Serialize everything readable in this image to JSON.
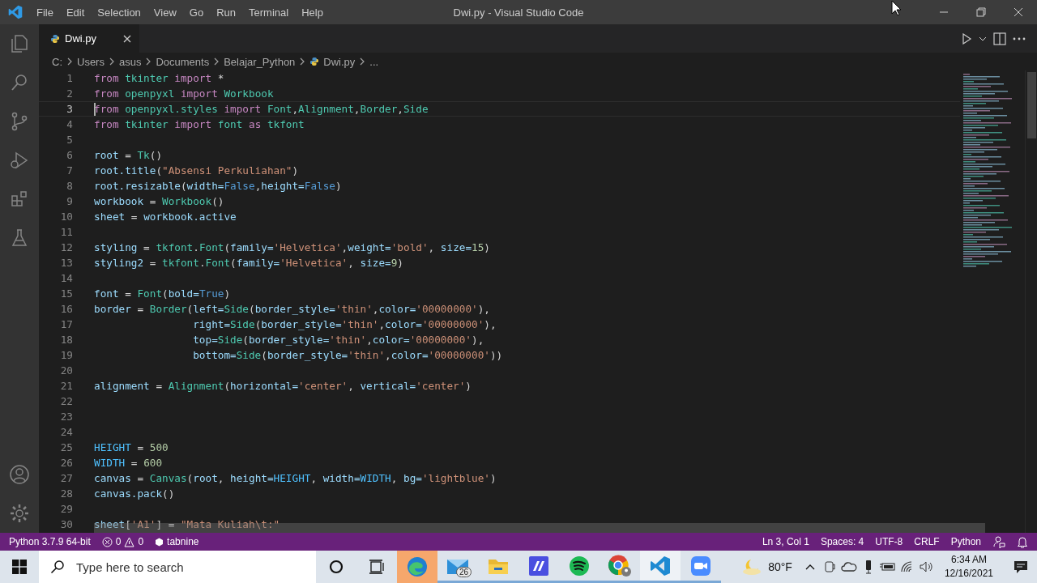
{
  "window": {
    "title": "Dwi.py - Visual Studio Code"
  },
  "menu": [
    "File",
    "Edit",
    "Selection",
    "View",
    "Go",
    "Run",
    "Terminal",
    "Help"
  ],
  "tabs": [
    {
      "label": "Dwi.py",
      "selected": true
    }
  ],
  "breadcrumbs": [
    {
      "label": "C:",
      "kind": "text"
    },
    {
      "label": "Users",
      "kind": "text"
    },
    {
      "label": "asus",
      "kind": "text"
    },
    {
      "label": "Documents",
      "kind": "text"
    },
    {
      "label": "Belajar_Python",
      "kind": "text"
    },
    {
      "label": "Dwi.py",
      "kind": "file"
    },
    {
      "label": "...",
      "kind": "text"
    }
  ],
  "lines": [
    {
      "number": "1",
      "current": false,
      "tokens": [
        {
          "text": "from",
          "kind": "kw"
        },
        {
          "text": " tkinter",
          "kind": "mod"
        },
        {
          "text": " import",
          "kind": "kw"
        },
        {
          "text": " *",
          "kind": "op"
        }
      ]
    },
    {
      "number": "2",
      "current": false,
      "tokens": [
        {
          "text": "from",
          "kind": "kw"
        },
        {
          "text": " openpyxl",
          "kind": "mod"
        },
        {
          "text": " import",
          "kind": "kw"
        },
        {
          "text": " Workbook",
          "kind": "cls"
        }
      ]
    },
    {
      "number": "3",
      "current": true,
      "tokens": [
        {
          "text": "from",
          "kind": "kw"
        },
        {
          "text": " openpyxl.styles",
          "kind": "mod"
        },
        {
          "text": " import",
          "kind": "kw"
        },
        {
          "text": " Font",
          "kind": "cls"
        },
        {
          "text": ",",
          "kind": "op"
        },
        {
          "text": "Alignment",
          "kind": "cls"
        },
        {
          "text": ",",
          "kind": "op"
        },
        {
          "text": "Border",
          "kind": "cls"
        },
        {
          "text": ",",
          "kind": "op"
        },
        {
          "text": "Side",
          "kind": "cls"
        }
      ]
    },
    {
      "number": "4",
      "current": false,
      "tokens": [
        {
          "text": "from",
          "kind": "kw"
        },
        {
          "text": " tkinter",
          "kind": "mod"
        },
        {
          "text": " import",
          "kind": "kw"
        },
        {
          "text": " font",
          "kind": "mod"
        },
        {
          "text": " as",
          "kind": "kw"
        },
        {
          "text": " tkfont",
          "kind": "mod"
        }
      ]
    },
    {
      "number": "5",
      "current": false
    },
    {
      "number": "6",
      "current": false,
      "tokens": [
        {
          "text": "root",
          "kind": "var"
        },
        {
          "text": " = ",
          "kind": "op"
        },
        {
          "text": "Tk",
          "kind": "cls"
        },
        {
          "text": "()",
          "kind": "op"
        }
      ]
    },
    {
      "number": "7",
      "current": false,
      "tokens": [
        {
          "text": "root.title",
          "kind": "var"
        },
        {
          "text": "(",
          "kind": "op"
        },
        {
          "text": "\"Absensi Perkuliahan\"",
          "kind": "str"
        },
        {
          "text": ")",
          "kind": "op"
        }
      ]
    },
    {
      "number": "8",
      "current": false,
      "tokens": [
        {
          "text": "root.resizable",
          "kind": "var"
        },
        {
          "text": "(",
          "kind": "op"
        },
        {
          "text": "width=",
          "kind": "var"
        },
        {
          "text": "False",
          "kind": "bool"
        },
        {
          "text": ",",
          "kind": "op"
        },
        {
          "text": "height=",
          "kind": "var"
        },
        {
          "text": "False",
          "kind": "bool"
        },
        {
          "text": ")",
          "kind": "op"
        }
      ]
    },
    {
      "number": "9",
      "current": false,
      "tokens": [
        {
          "text": "workbook",
          "kind": "var"
        },
        {
          "text": " = ",
          "kind": "op"
        },
        {
          "text": "Workbook",
          "kind": "cls"
        },
        {
          "text": "()",
          "kind": "op"
        }
      ]
    },
    {
      "number": "10",
      "current": false,
      "tokens": [
        {
          "text": "sheet",
          "kind": "var"
        },
        {
          "text": " = ",
          "kind": "op"
        },
        {
          "text": "workbook.active",
          "kind": "var"
        }
      ]
    },
    {
      "number": "11",
      "current": false
    },
    {
      "number": "12",
      "current": false,
      "tokens": [
        {
          "text": "styling",
          "kind": "var"
        },
        {
          "text": " = ",
          "kind": "op"
        },
        {
          "text": "tkfont",
          "kind": "mod"
        },
        {
          "text": ".",
          "kind": "op"
        },
        {
          "text": "Font",
          "kind": "cls"
        },
        {
          "text": "(",
          "kind": "op"
        },
        {
          "text": "family=",
          "kind": "var"
        },
        {
          "text": "'Helvetica'",
          "kind": "str"
        },
        {
          "text": ",",
          "kind": "op"
        },
        {
          "text": "weight=",
          "kind": "var"
        },
        {
          "text": "'bold'",
          "kind": "str"
        },
        {
          "text": ", ",
          "kind": "op"
        },
        {
          "text": "size=",
          "kind": "var"
        },
        {
          "text": "15",
          "kind": "num"
        },
        {
          "text": ")",
          "kind": "op"
        }
      ]
    },
    {
      "number": "13",
      "current": false,
      "tokens": [
        {
          "text": "styling2",
          "kind": "var"
        },
        {
          "text": " = ",
          "kind": "op"
        },
        {
          "text": "tkfont",
          "kind": "mod"
        },
        {
          "text": ".",
          "kind": "op"
        },
        {
          "text": "Font",
          "kind": "cls"
        },
        {
          "text": "(",
          "kind": "op"
        },
        {
          "text": "family=",
          "kind": "var"
        },
        {
          "text": "'Helvetica'",
          "kind": "str"
        },
        {
          "text": ", ",
          "kind": "op"
        },
        {
          "text": "size=",
          "kind": "var"
        },
        {
          "text": "9",
          "kind": "num"
        },
        {
          "text": ")",
          "kind": "op"
        }
      ]
    },
    {
      "number": "14",
      "current": false
    },
    {
      "number": "15",
      "current": false,
      "tokens": [
        {
          "text": "font",
          "kind": "var"
        },
        {
          "text": " = ",
          "kind": "op"
        },
        {
          "text": "Font",
          "kind": "cls"
        },
        {
          "text": "(",
          "kind": "op"
        },
        {
          "text": "bold=",
          "kind": "var"
        },
        {
          "text": "True",
          "kind": "bool"
        },
        {
          "text": ")",
          "kind": "op"
        }
      ]
    },
    {
      "number": "16",
      "current": false,
      "tokens": [
        {
          "text": "border",
          "kind": "var"
        },
        {
          "text": " = ",
          "kind": "op"
        },
        {
          "text": "Border",
          "kind": "cls"
        },
        {
          "text": "(",
          "kind": "op"
        },
        {
          "text": "left=",
          "kind": "var"
        },
        {
          "text": "Side",
          "kind": "cls"
        },
        {
          "text": "(",
          "kind": "op"
        },
        {
          "text": "border_style=",
          "kind": "var"
        },
        {
          "text": "'thin'",
          "kind": "str"
        },
        {
          "text": ",",
          "kind": "op"
        },
        {
          "text": "color=",
          "kind": "var"
        },
        {
          "text": "'00000000'",
          "kind": "str"
        },
        {
          "text": "),",
          "kind": "op"
        }
      ]
    },
    {
      "number": "17",
      "current": false,
      "tokens": [
        {
          "text": "                right=",
          "kind": "var"
        },
        {
          "text": "Side",
          "kind": "cls"
        },
        {
          "text": "(",
          "kind": "op"
        },
        {
          "text": "border_style=",
          "kind": "var"
        },
        {
          "text": "'thin'",
          "kind": "str"
        },
        {
          "text": ",",
          "kind": "op"
        },
        {
          "text": "color=",
          "kind": "var"
        },
        {
          "text": "'00000000'",
          "kind": "str"
        },
        {
          "text": "),",
          "kind": "op"
        }
      ]
    },
    {
      "number": "18",
      "current": false,
      "tokens": [
        {
          "text": "                top=",
          "kind": "var"
        },
        {
          "text": "Side",
          "kind": "cls"
        },
        {
          "text": "(",
          "kind": "op"
        },
        {
          "text": "border_style=",
          "kind": "var"
        },
        {
          "text": "'thin'",
          "kind": "str"
        },
        {
          "text": ",",
          "kind": "op"
        },
        {
          "text": "color=",
          "kind": "var"
        },
        {
          "text": "'00000000'",
          "kind": "str"
        },
        {
          "text": "),",
          "kind": "op"
        }
      ]
    },
    {
      "number": "19",
      "current": false,
      "tokens": [
        {
          "text": "                bottom=",
          "kind": "var"
        },
        {
          "text": "Side",
          "kind": "cls"
        },
        {
          "text": "(",
          "kind": "op"
        },
        {
          "text": "border_style=",
          "kind": "var"
        },
        {
          "text": "'thin'",
          "kind": "str"
        },
        {
          "text": ",",
          "kind": "op"
        },
        {
          "text": "color=",
          "kind": "var"
        },
        {
          "text": "'00000000'",
          "kind": "str"
        },
        {
          "text": "))",
          "kind": "op"
        }
      ]
    },
    {
      "number": "20",
      "current": false
    },
    {
      "number": "21",
      "current": false,
      "tokens": [
        {
          "text": "alignment",
          "kind": "var"
        },
        {
          "text": " = ",
          "kind": "op"
        },
        {
          "text": "Alignment",
          "kind": "cls"
        },
        {
          "text": "(",
          "kind": "op"
        },
        {
          "text": "horizontal=",
          "kind": "var"
        },
        {
          "text": "'center'",
          "kind": "str"
        },
        {
          "text": ", ",
          "kind": "op"
        },
        {
          "text": "vertical=",
          "kind": "var"
        },
        {
          "text": "'center'",
          "kind": "str"
        },
        {
          "text": ")",
          "kind": "op"
        }
      ]
    },
    {
      "number": "22",
      "current": false
    },
    {
      "number": "23",
      "current": false
    },
    {
      "number": "24",
      "current": false
    },
    {
      "number": "25",
      "current": false,
      "tokens": [
        {
          "text": "HEIGHT",
          "kind": "const"
        },
        {
          "text": " = ",
          "kind": "op"
        },
        {
          "text": "500",
          "kind": "num"
        }
      ]
    },
    {
      "number": "26",
      "current": false,
      "tokens": [
        {
          "text": "WIDTH",
          "kind": "const"
        },
        {
          "text": " = ",
          "kind": "op"
        },
        {
          "text": "600",
          "kind": "num"
        }
      ]
    },
    {
      "number": "27",
      "current": false,
      "tokens": [
        {
          "text": "canvas",
          "kind": "var"
        },
        {
          "text": " = ",
          "kind": "op"
        },
        {
          "text": "Canvas",
          "kind": "cls"
        },
        {
          "text": "(",
          "kind": "op"
        },
        {
          "text": "root",
          "kind": "var"
        },
        {
          "text": ", ",
          "kind": "op"
        },
        {
          "text": "height=",
          "kind": "var"
        },
        {
          "text": "HEIGHT",
          "kind": "const"
        },
        {
          "text": ", ",
          "kind": "op"
        },
        {
          "text": "width=",
          "kind": "var"
        },
        {
          "text": "WIDTH",
          "kind": "const"
        },
        {
          "text": ", ",
          "kind": "op"
        },
        {
          "text": "bg=",
          "kind": "var"
        },
        {
          "text": "'lightblue'",
          "kind": "str"
        },
        {
          "text": ")",
          "kind": "op"
        }
      ]
    },
    {
      "number": "28",
      "current": false,
      "tokens": [
        {
          "text": "canvas.pack",
          "kind": "var"
        },
        {
          "text": "()",
          "kind": "op"
        }
      ]
    },
    {
      "number": "29",
      "current": false
    },
    {
      "number": "30",
      "current": false,
      "tokens": [
        {
          "text": "sheet",
          "kind": "var"
        },
        {
          "text": "[",
          "kind": "op"
        },
        {
          "text": "'A1'",
          "kind": "str"
        },
        {
          "text": "] = ",
          "kind": "op"
        },
        {
          "text": "\"Mata Kuliah\\t:\"",
          "kind": "str"
        }
      ]
    }
  ],
  "status_bar": {
    "interpreter": "Python 3.7.9 64-bit",
    "errors": "0",
    "warnings": "0",
    "extension": "tabnine",
    "position": "Ln 3, Col 1",
    "indent": "Spaces: 4",
    "encoding": "UTF-8",
    "eol": "CRLF",
    "language": "Python"
  },
  "taskbar": {
    "search": {
      "placeholder": "Type here to search"
    },
    "apps": [
      {
        "kind": "browser",
        "running": false,
        "highlighted": true,
        "selected": false
      },
      {
        "kind": "mail",
        "running": true,
        "highlighted": false,
        "selected": false,
        "badge": "26"
      },
      {
        "kind": "folder",
        "running": true,
        "highlighted": false,
        "selected": false
      },
      {
        "kind": "tile",
        "running": true,
        "highlighted": false,
        "selected": false
      },
      {
        "kind": "music",
        "running": true,
        "highlighted": false,
        "selected": false
      },
      {
        "kind": "globe",
        "running": true,
        "highlighted": false,
        "selected": false
      },
      {
        "kind": "code",
        "running": true,
        "highlighted": false,
        "selected": true
      },
      {
        "kind": "video",
        "running": true,
        "highlighted": false,
        "selected": false
      }
    ],
    "weather": "80°F",
    "time": "6:34 AM",
    "date": "12/16/2021"
  }
}
